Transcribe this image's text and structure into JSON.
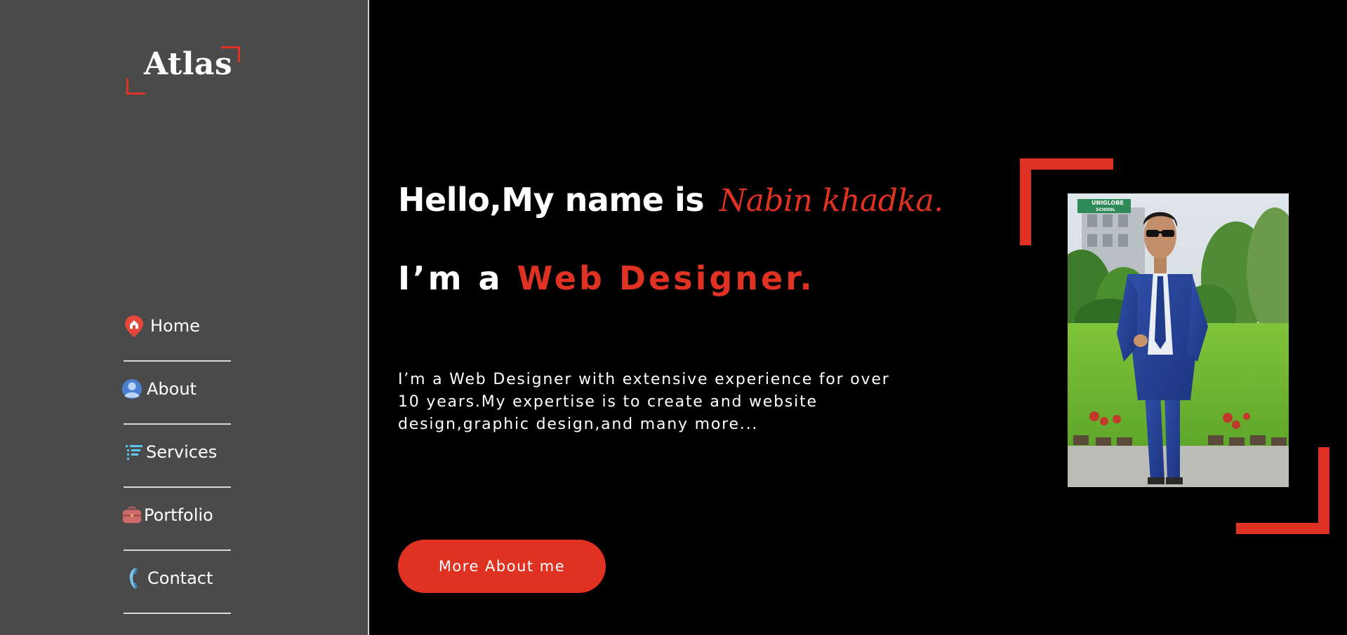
{
  "brand": {
    "logo_text": "Atlas",
    "accent_color": "#e03222"
  },
  "sidebar": {
    "background": "#4a4a4a",
    "items": [
      {
        "label": "Home",
        "icon": "home-pin-icon"
      },
      {
        "label": "About",
        "icon": "user-icon"
      },
      {
        "label": "Services",
        "icon": "list-icon"
      },
      {
        "label": "Portfolio",
        "icon": "briefcase-icon"
      },
      {
        "label": "Contact",
        "icon": "phone-icon"
      }
    ]
  },
  "hero": {
    "greeting": "Hello,My name is",
    "name": "Nabin khadka.",
    "role_prefix": "I’m a",
    "role": "Web Designer.",
    "intro": "I’m a Web Designer with extensive experience for over 10 years.My expertise is to create and website design,graphic design,and many more...",
    "cta_label": "More About me"
  },
  "photo": {
    "sign_line1": "UNIGLOBE",
    "sign_line2": "SCHOOL"
  }
}
